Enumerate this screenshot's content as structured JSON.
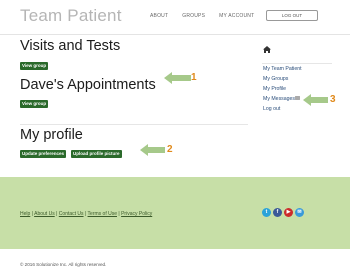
{
  "header": {
    "brand": "Team Patient",
    "nav": [
      "ABOUT",
      "GROUPS",
      "MY ACCOUNT"
    ],
    "logout_label": "LOG OUT"
  },
  "main": {
    "sections": [
      {
        "title": "Visits and Tests",
        "button": "View group"
      },
      {
        "title": "Dave's Appointments",
        "button": "View group"
      }
    ],
    "profile": {
      "title": "My profile",
      "buttons": [
        "Update preferences",
        "Upload profile picture"
      ]
    }
  },
  "sidebar": {
    "links": [
      "My Team Patient",
      "My Groups",
      "My Profile",
      "My Messages",
      "Log out"
    ]
  },
  "callouts": [
    "1",
    "2",
    "3"
  ],
  "callout_color": "#a6c98a",
  "footer": {
    "links": [
      "Help",
      "About Us",
      "Contact Us",
      "Terms of Use",
      "Privacy Policy"
    ],
    "separator": "|",
    "social": [
      {
        "name": "twitter-icon",
        "glyph": "t",
        "color": "#2aa3d9"
      },
      {
        "name": "facebook-icon",
        "glyph": "f",
        "color": "#3b5998"
      },
      {
        "name": "youtube-icon",
        "glyph": "▶",
        "color": "#cc2b2b"
      },
      {
        "name": "email-icon",
        "glyph": "✉",
        "color": "#3a9ad9"
      }
    ],
    "copyright": "© 2016 Solutionize Inc. All rights reserved."
  },
  "colors": {
    "footer_bg": "#c7dfa7",
    "button_bg": "#2b6a2b",
    "link": "#2a4d7a"
  }
}
